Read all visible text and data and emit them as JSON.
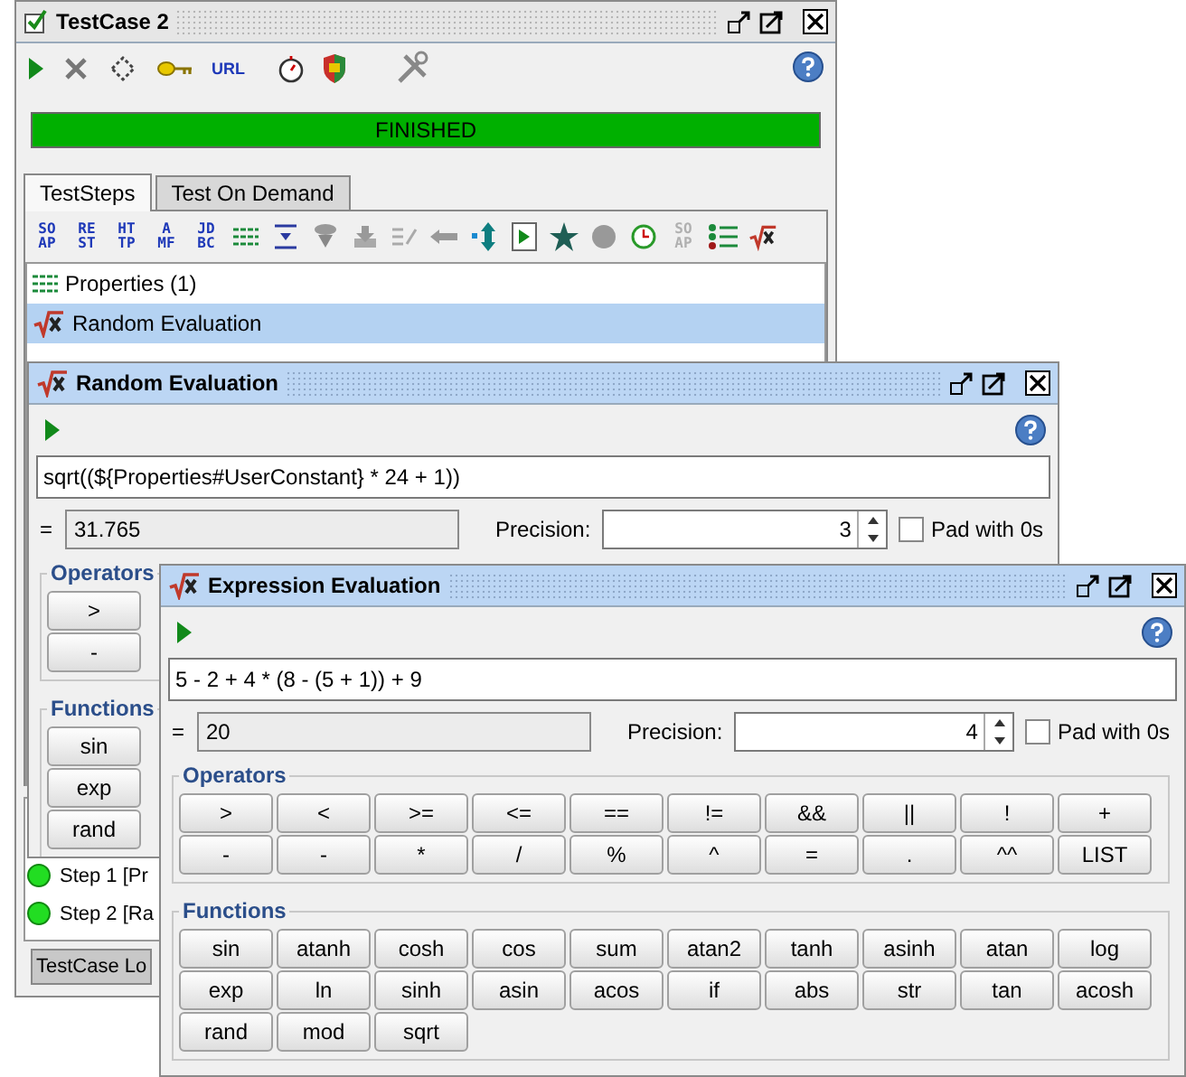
{
  "windows": [
    {
      "kind": "testcase",
      "title": "TestCase 2",
      "active": false,
      "toolbar": {
        "url_label": "URL"
      },
      "progress": {
        "label": "FINISHED",
        "level": 1
      },
      "tabs": [
        {
          "label": "TestSteps",
          "selected": true
        },
        {
          "label": "Test On Demand",
          "selected": false
        }
      ],
      "step_toolbar": [
        {
          "lines": [
            "SO",
            "AP"
          ],
          "disabled": false
        },
        {
          "lines": [
            "RE",
            "ST"
          ],
          "disabled": false
        },
        {
          "lines": [
            "HT",
            "TP"
          ],
          "disabled": false
        },
        {
          "lines": [
            "A",
            "MF"
          ],
          "disabled": false
        },
        {
          "lines": [
            "JD",
            "BC"
          ],
          "disabled": false
        },
        {
          "lines": [
            "SO",
            "AP"
          ],
          "disabled": true
        }
      ],
      "steps": [
        {
          "kind": "properties",
          "label": "Properties (1)",
          "selected": false
        },
        {
          "kind": "evaluation",
          "label": "Random Evaluation",
          "selected": true
        }
      ],
      "log": {
        "entries": [
          {
            "label": "Step 1 [Pr"
          },
          {
            "label": "Step 2 [Ra"
          }
        ],
        "tab": "TestCase Lo"
      }
    },
    {
      "kind": "evaluation",
      "title": "Random Evaluation",
      "active": true,
      "expression": "sqrt((${Properties#UserConstant} * 24 + 1))",
      "result_label": "=",
      "result": "31.765",
      "precision_label": "Precision:",
      "precision": "3",
      "pad_label": "Pad with 0s",
      "pad_checked": false,
      "operators_title": "Operators",
      "operators": [
        [
          ">"
        ],
        [
          "-"
        ]
      ],
      "functions_title": "Functions",
      "functions": [
        [
          "sin"
        ],
        [
          "exp"
        ],
        [
          "rand"
        ]
      ]
    },
    {
      "kind": "evaluation",
      "title": "Expression Evaluation",
      "active": true,
      "expression": "5 - 2 + 4 * (8 - (5 + 1)) + 9",
      "result_label": "=",
      "result": "20",
      "precision_label": "Precision:",
      "precision": "4",
      "pad_label": "Pad with 0s",
      "pad_checked": false,
      "operators_title": "Operators",
      "operators": [
        [
          ">",
          "<",
          ">=",
          "<=",
          "==",
          "!=",
          "&&",
          "||",
          "!",
          "+"
        ],
        [
          "-",
          "-",
          "*",
          "/",
          "%",
          "^",
          "=",
          ".",
          "^^",
          "LIST"
        ]
      ],
      "functions_title": "Functions",
      "functions": [
        [
          "sin",
          "atanh",
          "cosh",
          "cos",
          "sum",
          "atan2",
          "tanh",
          "asinh",
          "atan",
          "log"
        ],
        [
          "exp",
          "ln",
          "sinh",
          "asin",
          "acos",
          "if",
          "abs",
          "str",
          "tan",
          "acosh"
        ],
        [
          "rand",
          "mod",
          "sqrt"
        ]
      ]
    }
  ]
}
